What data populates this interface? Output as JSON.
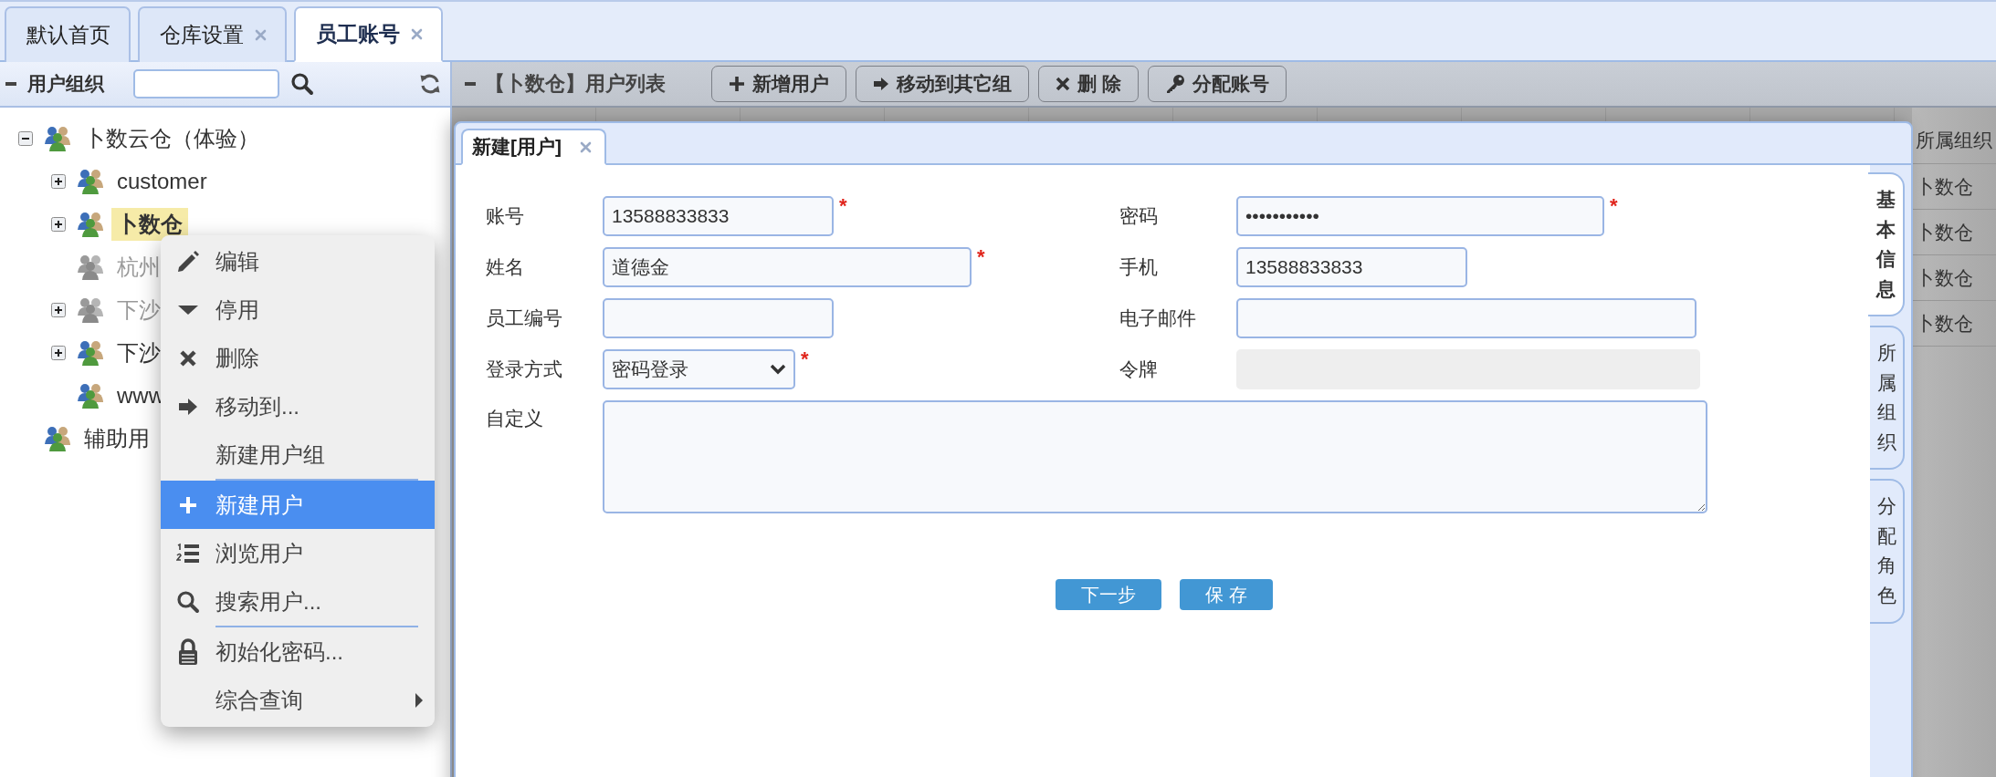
{
  "tabs": [
    {
      "label": "默认首页",
      "closable": false,
      "selected": false
    },
    {
      "label": "仓库设置",
      "closable": true,
      "selected": false
    },
    {
      "label": "员工账号",
      "closable": true,
      "selected": true
    }
  ],
  "left_panel": {
    "title": "用户组织"
  },
  "tree": [
    {
      "label": "卜数云仓（体验）",
      "expanded": true,
      "selected": false,
      "disabled": false,
      "children": [
        {
          "label": "customer",
          "expanded": false,
          "selected": false,
          "disabled": false
        },
        {
          "label": "卜数仓",
          "expanded": false,
          "selected": true,
          "disabled": false
        },
        {
          "label": "杭州",
          "selected": false,
          "disabled": true
        },
        {
          "label": "下沙",
          "expanded": false,
          "selected": false,
          "disabled": true
        },
        {
          "label": "下沙",
          "expanded": false,
          "selected": false,
          "disabled": false
        },
        {
          "label": "www",
          "selected": false,
          "disabled": false
        }
      ]
    },
    {
      "label": "辅助用",
      "selected": false,
      "disabled": false
    }
  ],
  "user_list": {
    "title": "【卜数仓】用户列表",
    "buttons": [
      "新增用户",
      "移动到其它组",
      "删 除",
      "分配账号"
    ],
    "columns": [
      {
        "header": "所属组织",
        "cells": [
          "卜数仓",
          "卜数仓",
          "卜数仓",
          "卜数仓"
        ]
      }
    ]
  },
  "context_menu": {
    "groups": [
      [
        {
          "label": "编辑",
          "selected": false,
          "submenu": false
        },
        {
          "label": "停用",
          "selected": false,
          "submenu": false
        },
        {
          "label": "删除",
          "selected": false,
          "submenu": false
        },
        {
          "label": "移动到...",
          "selected": false,
          "submenu": false
        },
        {
          "label": "新建用户组",
          "selected": false,
          "submenu": false
        }
      ],
      [
        {
          "label": "新建用户",
          "selected": true,
          "submenu": false
        },
        {
          "label": "浏览用户",
          "selected": false,
          "submenu": false
        },
        {
          "label": "搜索用户...",
          "selected": false,
          "submenu": false
        }
      ],
      [
        {
          "label": "初始化密码...",
          "selected": false,
          "submenu": false
        },
        {
          "label": "综合查询",
          "selected": false,
          "submenu": true
        }
      ]
    ]
  },
  "dialog": {
    "tab": "新建[用户]",
    "fields": [
      {
        "label": "账号",
        "kind": "text",
        "value": "13588833833",
        "required_mark": "*"
      },
      {
        "label": "密码",
        "kind": "text",
        "value": "•••••••••••",
        "required_mark": "*"
      },
      {
        "label": "姓名",
        "kind": "text",
        "value": "道德金",
        "required_mark": "*"
      },
      {
        "label": "手机",
        "kind": "text",
        "value": "13588833833"
      },
      {
        "label": "员工编号",
        "kind": "text"
      },
      {
        "label": "电子邮件",
        "kind": "text"
      },
      {
        "label": "登录方式",
        "kind": "select",
        "value": "密码登录",
        "required_mark": "*"
      },
      {
        "label": "令牌",
        "kind": "readonly"
      },
      {
        "label": "自定义",
        "kind": "textarea"
      }
    ],
    "buttons": [
      "下一步",
      "保 存"
    ],
    "side_tabs": [
      {
        "label": "基本信息",
        "selected": true
      },
      {
        "label": "所属组织",
        "selected": false
      },
      {
        "label": "分配角色",
        "selected": false
      }
    ]
  }
}
